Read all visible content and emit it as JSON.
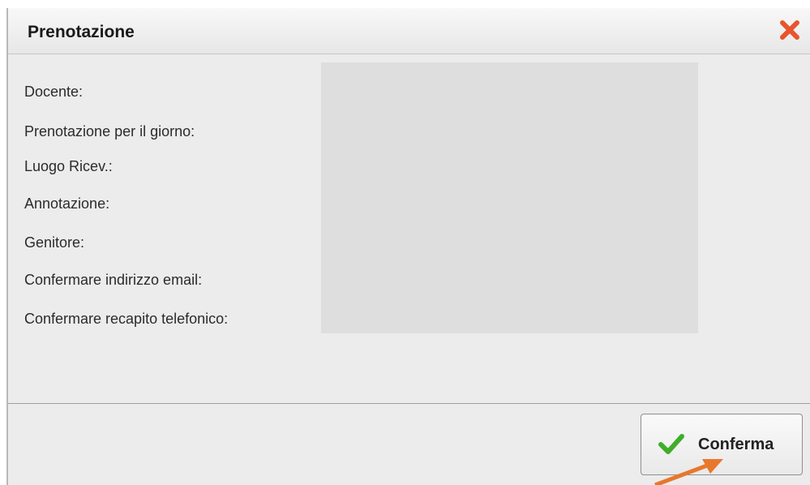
{
  "dialog": {
    "title": "Prenotazione",
    "close_icon": "close-icon"
  },
  "form": {
    "labels": [
      "Docente:",
      "Prenotazione per il giorno:",
      "Luogo Ricev.:",
      "Annotazione:",
      "Genitore:",
      "Confermare indirizzo email:",
      "Confermare recapito telefonico:"
    ]
  },
  "footer": {
    "confirm_label": "Conferma",
    "confirm_icon": "checkmark-icon"
  },
  "colors": {
    "close_red": "#e8542e",
    "check_green": "#3fae2a",
    "arrow_orange": "#e8772c",
    "values_panel": "#dedede"
  }
}
